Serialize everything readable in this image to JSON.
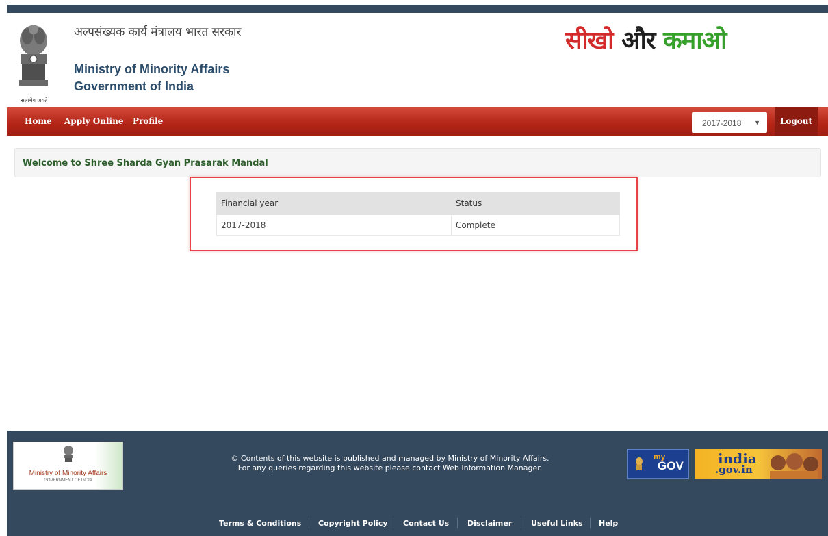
{
  "header": {
    "emblem_caption": "सत्यमेव जयते",
    "ministry_hindi": "अल्पसंख्यक कार्य मंत्रालय भारत सरकार",
    "ministry_english_1": "Ministry of Minority Affairs",
    "ministry_english_2": "Government of India",
    "slogan": {
      "part1": "सीखो",
      "part2": "और",
      "part3": "कमाओ"
    }
  },
  "navbar": {
    "links": [
      "Home",
      "Apply Online",
      "Profile"
    ],
    "year_select": {
      "selected": "2017-2018"
    },
    "logout_label": "Logout"
  },
  "welcome_text": "Welcome to Shree Sharda Gyan Prasarak Mandal",
  "status_table": {
    "columns": [
      "Financial year",
      "Status"
    ],
    "rows": [
      [
        "2017-2018",
        "Complete"
      ]
    ]
  },
  "footer": {
    "logo_line1": "Ministry of Minority Affairs",
    "logo_line2": "GOVERNMENT OF INDIA",
    "text_line1": "© Contents of this website is published and managed by Ministry of Minority Affairs.",
    "text_line2": "For any queries regarding this website please contact Web Information Manager.",
    "mygov_label": "GOV",
    "mygov_prefix": "my",
    "indiagov_label_1": "india",
    "indiagov_label_2": ".gov.in",
    "links": [
      "Terms & Conditions",
      "Copyright Policy",
      "Contact Us",
      "Disclaimer",
      "Useful Links",
      "Help"
    ]
  },
  "colors": {
    "nav_red": "#b22416",
    "logout_bg": "#8e1b10",
    "footer_bg": "#34495e",
    "highlight_border": "#e8414b",
    "welcome_text": "#2d5e2c",
    "ministry_text": "#2b4c6a"
  }
}
